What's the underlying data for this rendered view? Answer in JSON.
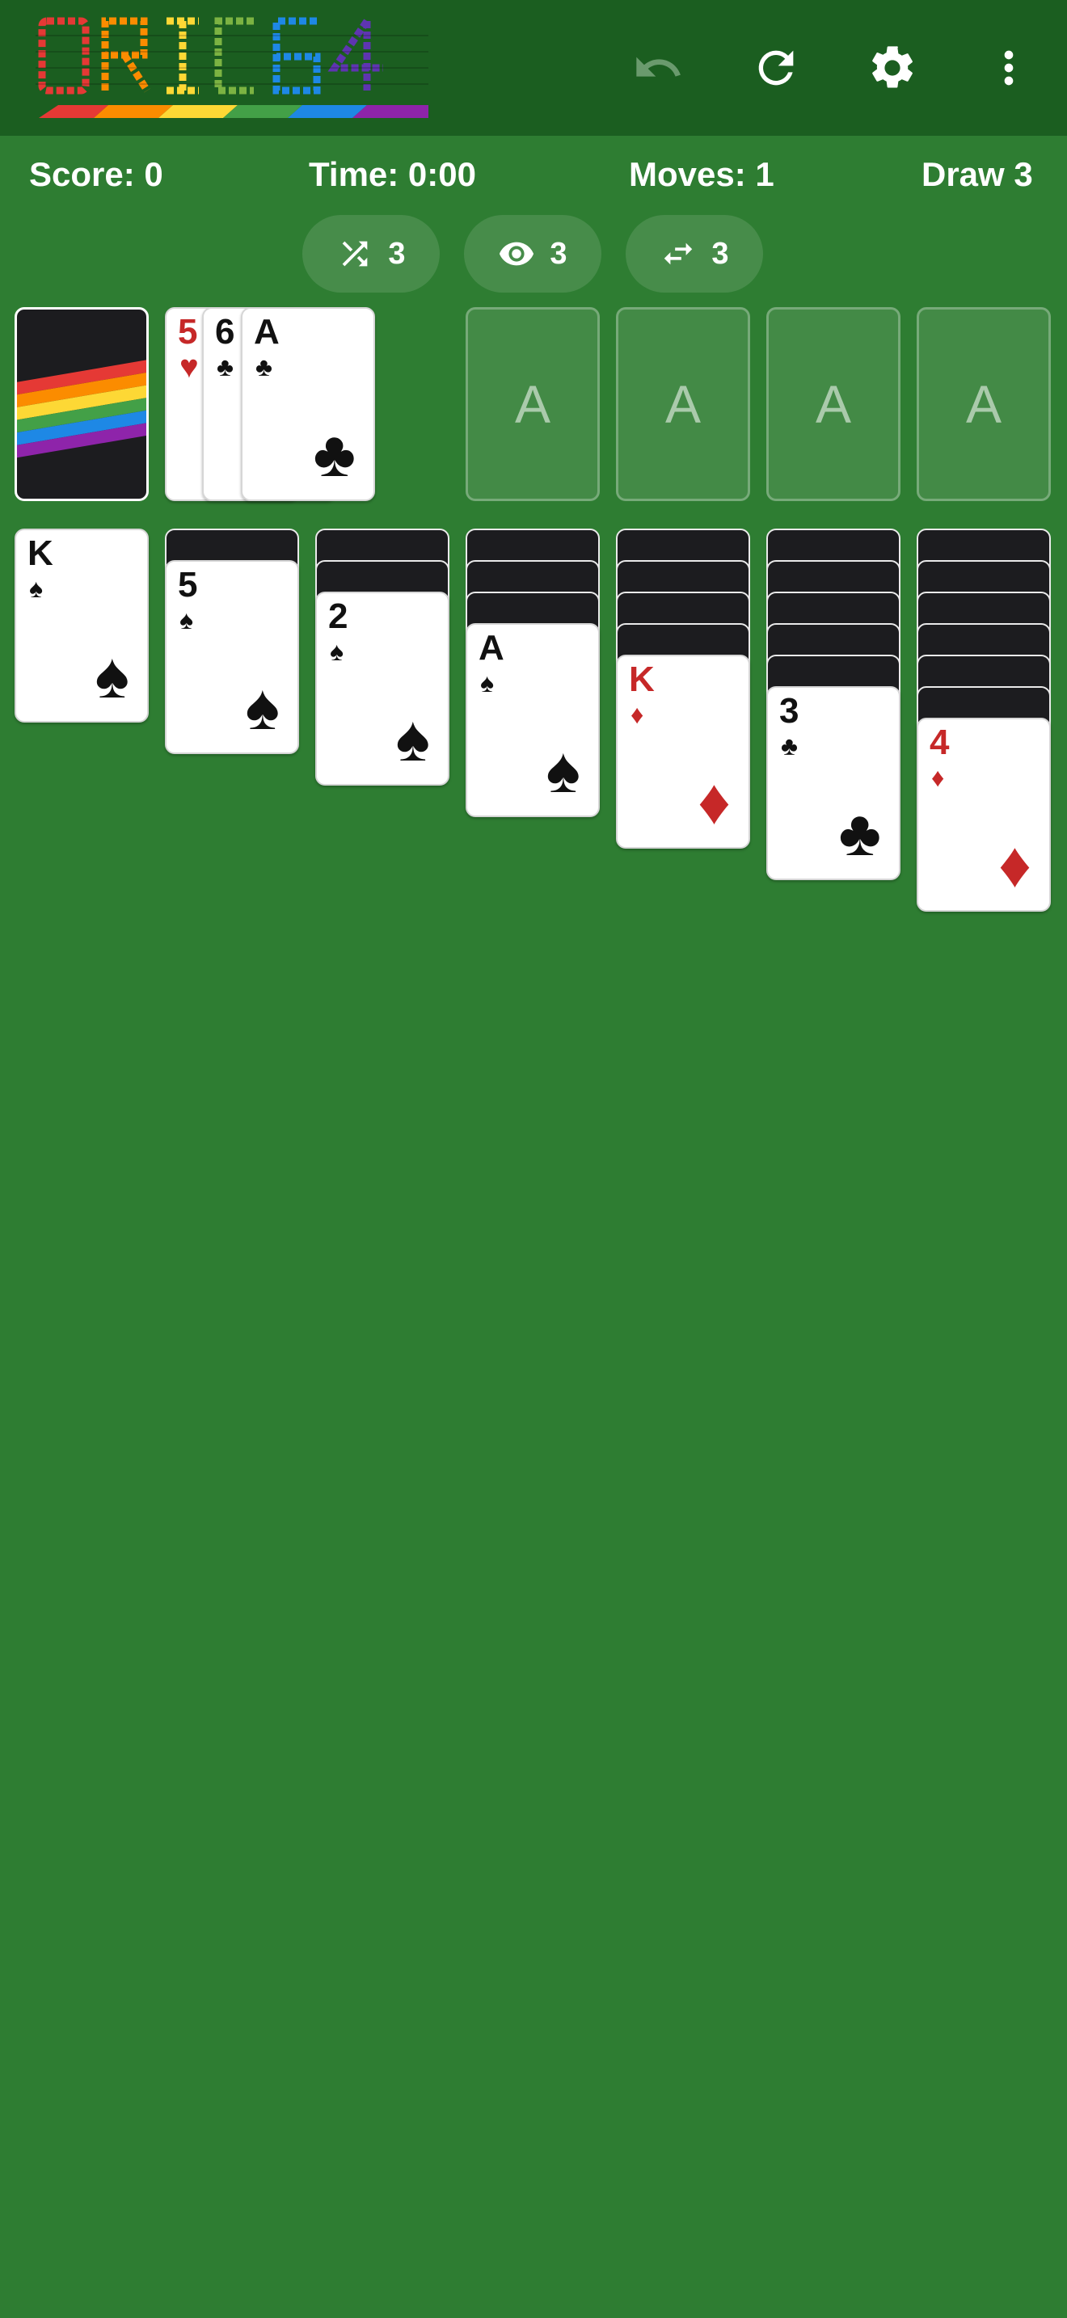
{
  "app": {
    "logo_text": "ORIC64",
    "icons": {
      "undo": "undo-icon",
      "restart": "restart-icon",
      "settings": "gear-icon",
      "menu": "more-vert-icon"
    }
  },
  "status": {
    "score": "Score: 0",
    "time": "Time: 0:00",
    "moves": "Moves: 1",
    "draw": "Draw 3"
  },
  "pills": [
    {
      "icon": "shuffle-icon",
      "value": "3"
    },
    {
      "icon": "eye-icon",
      "value": "3"
    },
    {
      "icon": "swap-icon",
      "value": "3"
    }
  ],
  "waste": [
    {
      "rank": "5",
      "suit": "♥",
      "color": "red"
    },
    {
      "rank": "6",
      "suit": "♣",
      "color": "black"
    },
    {
      "rank": "A",
      "suit": "♣",
      "color": "black"
    }
  ],
  "foundations": [
    "A",
    "A",
    "A",
    "A"
  ],
  "tableau": [
    {
      "face_down": 0,
      "rank": "K",
      "suit": "♠",
      "color": "black"
    },
    {
      "face_down": 1,
      "rank": "5",
      "suit": "♠",
      "color": "black"
    },
    {
      "face_down": 2,
      "rank": "2",
      "suit": "♠",
      "color": "black"
    },
    {
      "face_down": 3,
      "rank": "A",
      "suit": "♠",
      "color": "black"
    },
    {
      "face_down": 4,
      "rank": "K",
      "suit": "♦",
      "color": "red"
    },
    {
      "face_down": 5,
      "rank": "3",
      "suit": "♣",
      "color": "black"
    },
    {
      "face_down": 6,
      "rank": "4",
      "suit": "♦",
      "color": "red"
    }
  ],
  "colors": {
    "felt": "#2e7d32",
    "topbar": "#1b5e20",
    "red_suit": "#c62828"
  }
}
